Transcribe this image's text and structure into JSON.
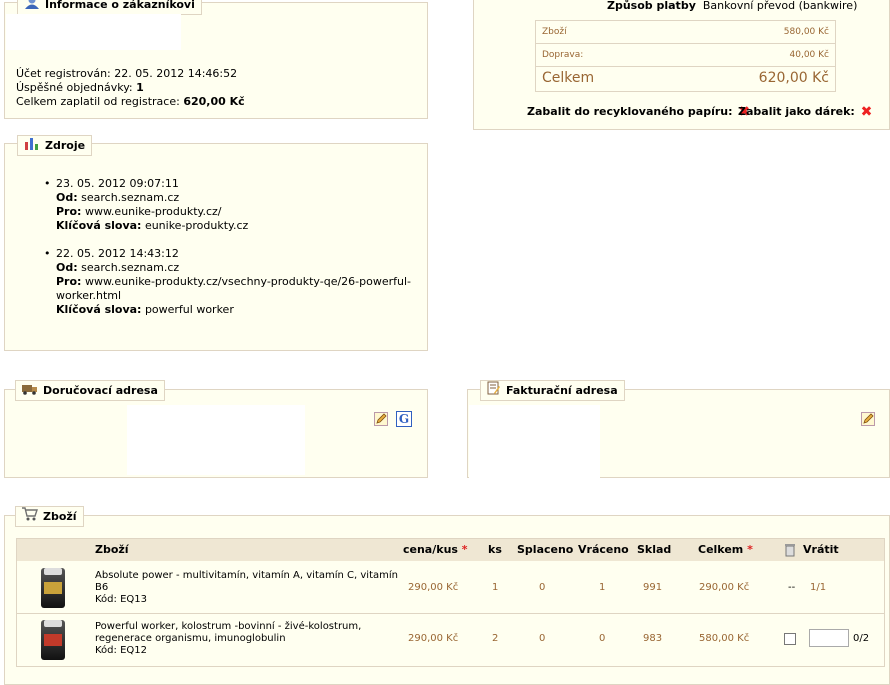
{
  "customer": {
    "legend": "Informace o zákazníkovi",
    "registered_label": "Účet registrován:",
    "registered_value": "22. 05. 2012 14:46:52",
    "orders_label": "Úspěšné objednávky:",
    "orders_value": "1",
    "total_label": "Celkem zaplatil od registrace:",
    "total_value": "620,00 Kč"
  },
  "payment": {
    "method_label": "Způsob platby",
    "method_value": "Bankovní převod (bankwire)",
    "rows": [
      {
        "label": "Zboží",
        "value": "580,00 Kč"
      },
      {
        "label": "Doprava:",
        "value": "40,00 Kč"
      },
      {
        "label": "Celkem",
        "value": "620,00 Kč"
      }
    ],
    "recycled_label": "Zabalit do recyklovaného papíru:",
    "gift_label": "Zabalit jako dárek:",
    "no_mark": "✖"
  },
  "sources": {
    "legend": "Zdroje",
    "from_label": "Od:",
    "to_label": "Pro:",
    "keywords_label": "Klíčová slova:",
    "items": [
      {
        "date": "23. 05. 2012 09:07:11",
        "from": "search.seznam.cz",
        "to": "www.eunike-produkty.cz/",
        "keywords": "eunike-produkty.cz"
      },
      {
        "date": "22. 05. 2012 14:43:12",
        "from": "search.seznam.cz",
        "to_line1": "www.eunike-produkty.cz/vsechny-produkty-qe/26-powerful-",
        "to_line2": "worker.html",
        "keywords": "powerful worker"
      }
    ]
  },
  "delivery": {
    "legend": "Doručovací adresa",
    "google_label": "G"
  },
  "invoice": {
    "legend": "Fakturační adresa"
  },
  "products": {
    "legend": "Zboží",
    "headers": {
      "product": "Zboží",
      "price": "cena/kus",
      "qty": "ks",
      "paid": "Splaceno",
      "returned": "Vráceno",
      "stock": "Sklad",
      "total": "Celkem",
      "refund": "Vrátit",
      "required_mark": "*"
    },
    "rows": [
      {
        "name1": "Absolute power - multivitamín, vitamín A, vitamín C, vitamín",
        "name2": "B6",
        "code": "Kód: EQ13",
        "price": "290,00 Kč",
        "qty": "1",
        "paid": "0",
        "returned": "1",
        "stock": "991",
        "total": "290,00 Kč",
        "refund_mark": "--",
        "refund_ratio": "1/1"
      },
      {
        "name1": "Powerful worker, kolostrum -bovinní - živé-kolostrum,",
        "name2": "regenerace organismu, imunoglobulin",
        "code": "Kód: EQ12",
        "price": "290,00 Kč",
        "qty": "2",
        "paid": "0",
        "returned": "0",
        "stock": "983",
        "total": "580,00 Kč",
        "refund_input": "",
        "refund_ratio": "0/2"
      }
    ]
  }
}
